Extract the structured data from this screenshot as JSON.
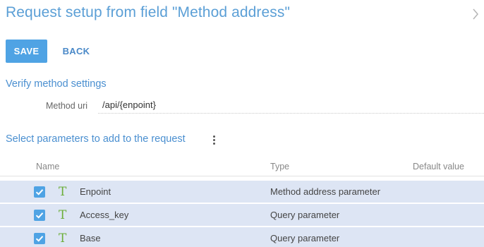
{
  "page": {
    "title": "Request setup from field \"Method address\""
  },
  "toolbar": {
    "save_label": "SAVE",
    "back_label": "BACK"
  },
  "verify": {
    "section_title": "Verify method settings",
    "method_uri_label": "Method uri",
    "method_uri_value": "/api/{enpoint}"
  },
  "params": {
    "section_title": "Select parameters to add to the request",
    "columns": {
      "name": "Name",
      "type": "Type",
      "default": "Default value"
    },
    "rows": [
      {
        "checked": true,
        "type_icon": "T",
        "name": "Enpoint",
        "type": "Method address parameter",
        "default": ""
      },
      {
        "checked": true,
        "type_icon": "T",
        "name": "Access_key",
        "type": "Query parameter",
        "default": ""
      },
      {
        "checked": true,
        "type_icon": "T",
        "name": "Base",
        "type": "Query parameter",
        "default": ""
      }
    ]
  },
  "colors": {
    "accent": "#4fa3e4",
    "title": "#5b9fd6",
    "row_selected": "#dde5f4",
    "text_type_icon": "#6cae3a"
  },
  "icons": {
    "close_panel": "chevron-right-icon",
    "menu": "kebab-menu-icon",
    "checkbox": "checkmark-icon",
    "text_type": "text-type-icon"
  }
}
